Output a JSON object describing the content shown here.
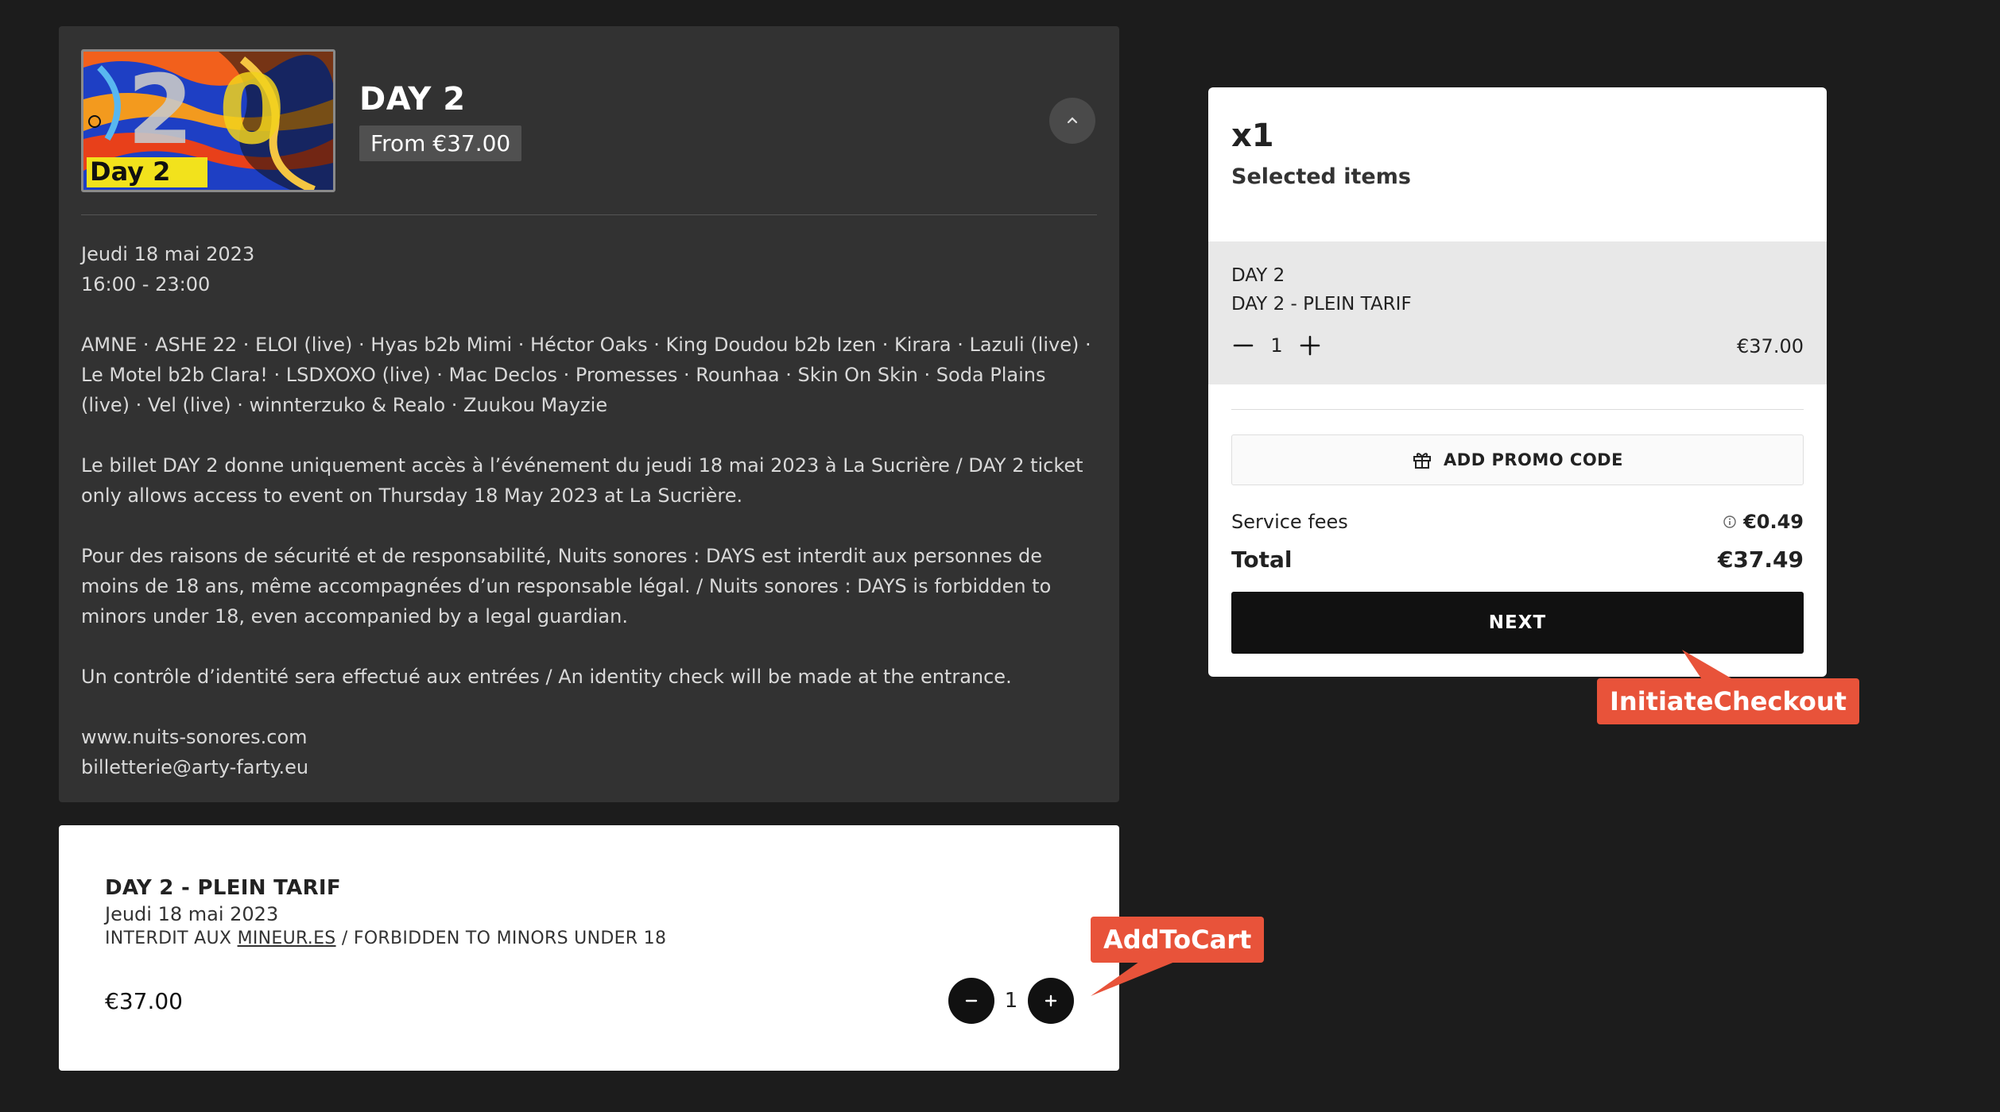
{
  "event": {
    "cover_lettering": "Day 2",
    "title": "DAY 2",
    "price_from": "From €37.00",
    "date": "Jeudi 18 mai 2023",
    "time": "16:00 - 23:00",
    "lineup": "AMNE · ASHE 22 · ELOI (live) · Hyas b2b Mimi · Héctor Oaks · King Doudou b2b Izen · Kirara · Lazuli (live) · Le Motel b2b Clara! · LSDXOXO (live) · Mac Declos · Promesses · Rounhaa · Skin On Skin · Soda Plains (live) · Vel (live) · winnterzuko & Realo · Zuukou Mayzie",
    "access_note": "Le billet DAY 2 donne uniquement accès à l’événement du jeudi 18 mai 2023 à La Sucrière / DAY 2 ticket only allows access to event on Thursday 18 May 2023 at La Sucrière.",
    "safety_note": "Pour des raisons de sécurité et de responsabilité, Nuits sonores : DAYS est interdit aux personnes de moins de 18 ans, même accompagnées d’un responsable légal. / Nuits sonores : DAYS is forbidden to minors under 18, even accompanied by a legal guardian.",
    "id_note": "Un contrôle d’identité sera effectué aux entrées / An identity check will be made at the entrance.",
    "website": "www.nuits-sonores.com",
    "email": "billetterie@arty-farty.eu"
  },
  "ticket": {
    "name": "DAY 2 - PLEIN TARIF",
    "date": "Jeudi 18 mai 2023",
    "restriction_prefix": "INTERDIT AUX ",
    "restriction_link": "MINEUR.ES",
    "restriction_suffix": " / FORBIDDEN TO MINORS UNDER 18",
    "price": "€37.00",
    "quantity": "1"
  },
  "cart": {
    "count": "x1",
    "subtitle": "Selected items",
    "item_event": "DAY 2",
    "item_ticket": "DAY 2 - PLEIN TARIF",
    "item_quantity": "1",
    "item_price": "€37.00",
    "promo_label": "ADD PROMO CODE",
    "fees_label": "Service fees",
    "fees_value": "€0.49",
    "total_label": "Total",
    "total_value": "€37.49",
    "next_label": "NEXT"
  },
  "annotations": {
    "add_to_cart": "AddToCart",
    "initiate_checkout": "InitiateCheckout",
    "color": "#e8533a"
  }
}
